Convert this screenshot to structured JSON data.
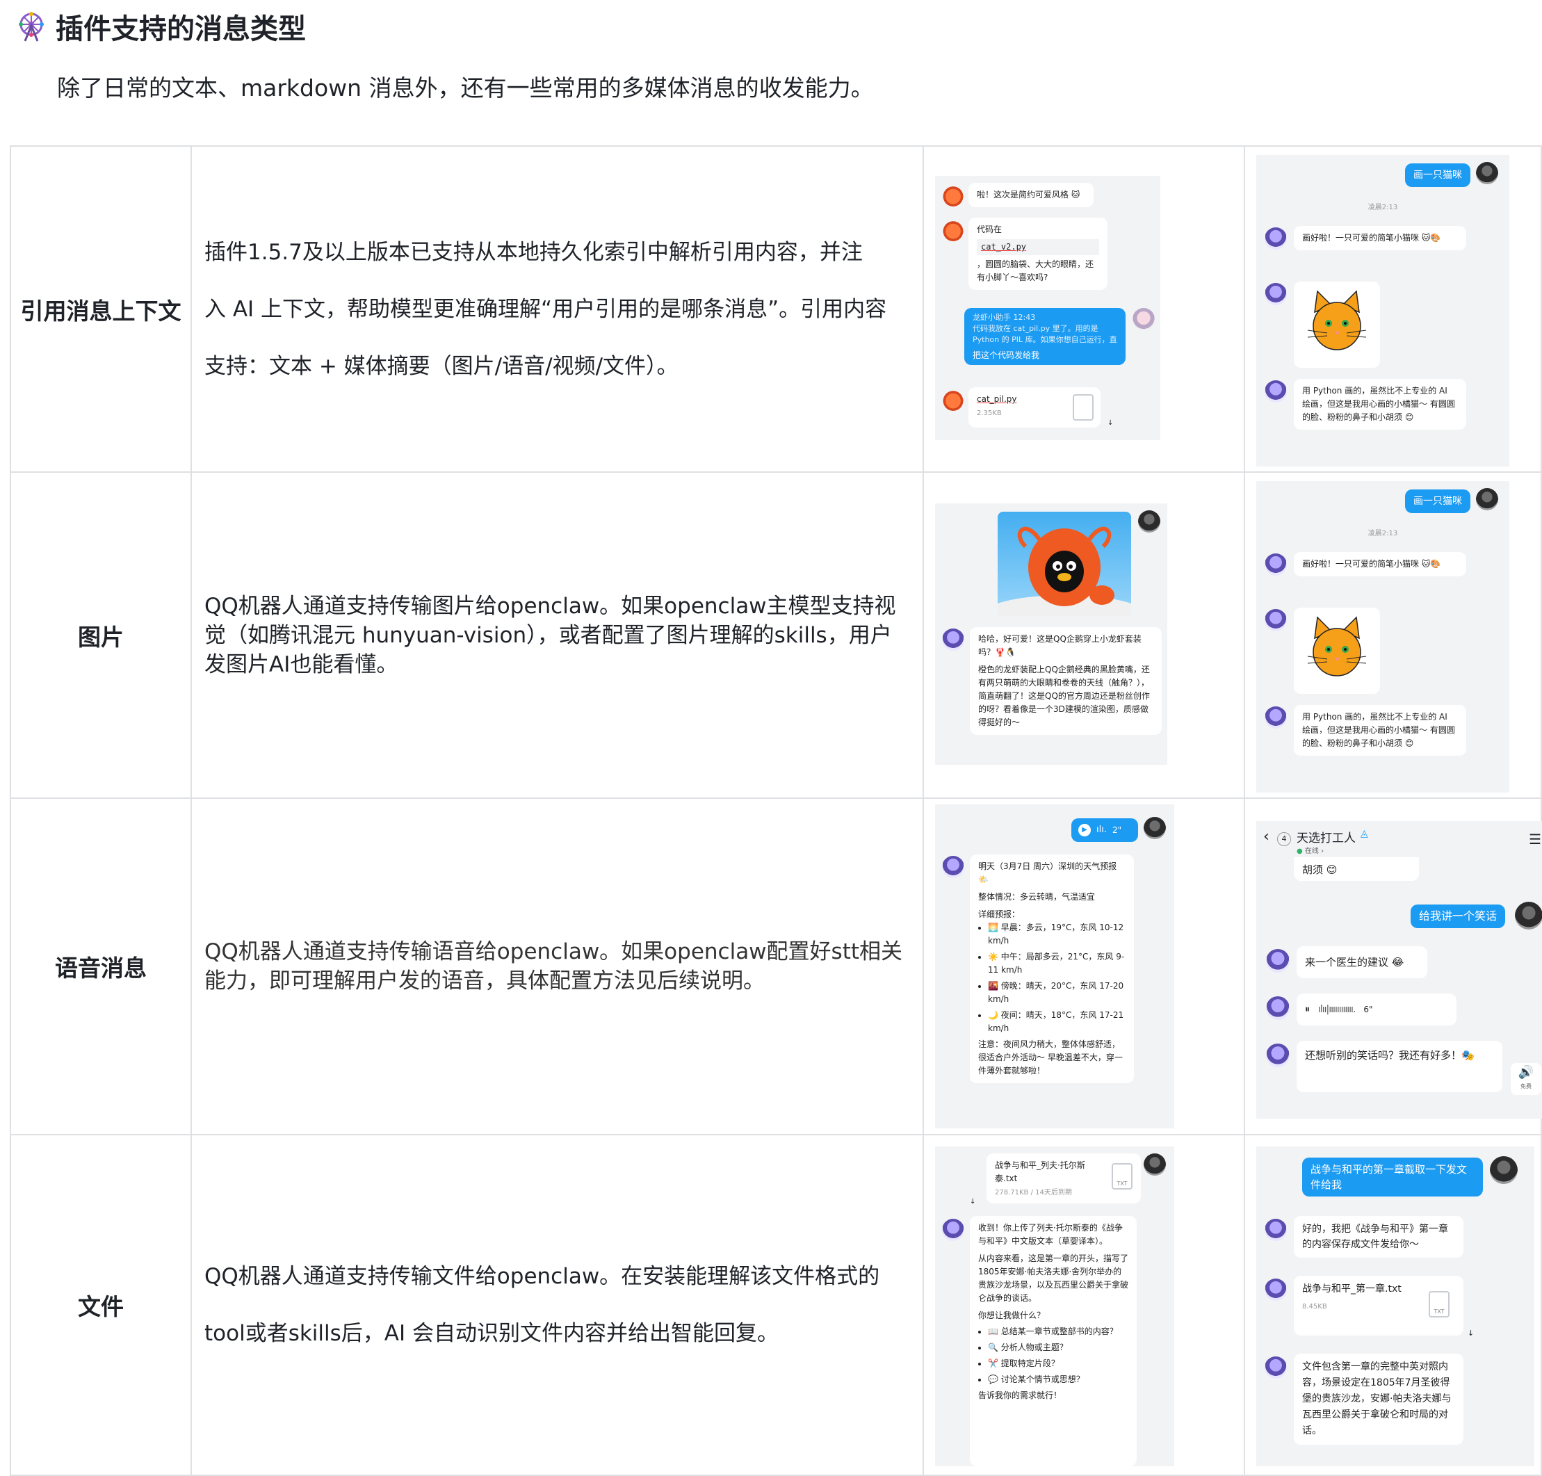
{
  "heading": {
    "icon": "ferris-wheel-icon",
    "title": "插件支持的消息类型"
  },
  "intro": "除了日常的文本、markdown 消息外，还有一些常用的多媒体消息的收发能力。",
  "rows": [
    {
      "label": "引用消息上下文",
      "desc_lines": [
        "插件1.5.7及以上版本已支持从本地持久化索引中解析引用内容，并注",
        "入 AI 上下文，帮助模型更准确理解“用户引用的是哪条消息”。引用内容",
        "支持：文本 + 媒体摘要（图片/语音/视频/文件）。"
      ]
    },
    {
      "label": "图片",
      "desc_lines": [
        "QQ机器人通道支持传输图片给openclaw。如果openclaw主模型支持视",
        "觉（如腾讯混元 hunyuan-vision），或者配置了图片理解的skills，用户",
        "发图片AI也能看懂。"
      ]
    },
    {
      "label": "语音消息",
      "desc_lines": [
        "QQ机器人通道支持传输语音给openclaw。如果openclaw配置好stt相关",
        "能力，即可理解用户发的语音，具体配置方法见后续说明。"
      ]
    },
    {
      "label": "文件",
      "desc_lines": [
        "QQ机器人通道支持传输文件给openclaw。在安装能理解该文件格式的",
        "tool或者skills后，AI 会自动识别文件内容并给出智能回复。"
      ]
    }
  ],
  "shots": {
    "quote_left": {
      "msg1": "啦！这次是简约可爱风格 🐱",
      "msg2_title": "代码在",
      "msg2_code": "cat_v2.py",
      "msg2_text": "，圆圆的脑袋、大大的眼睛，还有小脚丫～喜欢吗?",
      "quote_meta": "龙虾小助手 12:43",
      "quote_text": "代码我放在 cat_pil.py 里了。用的是 Python 的 PIL 库。如果你想自己运行，直接 pyt...",
      "quote_reply": "把这个代码发给我",
      "file_name": "cat_pil.py",
      "file_size": "2.35KB"
    },
    "draw_cat": {
      "user_msg": "画一只猫咪",
      "time": "凌晨2:13",
      "bot_msg1": "画好啦！一只可爱的简笔小猫咪 🐱🎨",
      "bot_msg2": "用 Python 画的，虽然比不上专业的 AI 绘画，但这是我用心画的小橘猫～ 有圆圆的脸、粉粉的鼻子和小胡须 😊"
    },
    "image_left": {
      "reply1": "哈哈，好可爱！这是QQ企鹅穿上小龙虾套装吗？🦞🐧",
      "reply2": "橙色的龙虾装配上QQ企鹅经典的黑脸黄嘴，还有两只萌萌的大眼睛和卷卷的天线（触角？），简直萌翻了！这是QQ的官方周边还是粉丝创作的呀？看着像是一个3D建模的渲染图，质感做得挺好的～"
    },
    "voice_left": {
      "duration": "2\"",
      "weather_title": "明天（3月7日 周六）深圳的天气预报 🌤️",
      "overall": "整体情况：多云转晴，气温适宜",
      "detail_label": "详细预报：",
      "items": [
        "🌅 早晨：多云，19°C，东风 10-12 km/h",
        "☀️ 中午：局部多云，21°C，东风 9-11 km/h",
        "🌇 傍晚：晴天，20°C，东风 17-20 km/h",
        "🌙 夜间：晴天，18°C，东风 17-21 km/h"
      ],
      "note": "注意：夜间风力稍大，整体体感舒适，很适合户外活动～ 早晚温差不大，穿一件薄外套就够啦！"
    },
    "voice_right": {
      "unread": "4",
      "contact": "天选打工人",
      "status": "在线 ›",
      "prev_tail": "胡须 😊",
      "user_msg": "给我讲一个笑话",
      "bot_msg1": "来一个医生的建议 😂",
      "voice_len": "6\"",
      "bot_msg2": "还想听别的笑话吗？我还有好多！🎭",
      "speaker_label": "免费"
    },
    "file_left": {
      "file_name": "战争与和平_列夫·托尔斯泰.txt",
      "file_meta": "278.71KB / 14天后到期",
      "reply_p1": "收到！你上传了列夫·托尔斯泰的《战争与和平》中文版文本（草婴译本）。",
      "reply_p2": "从内容来看，这是第一章的开头，描写了1805年安娜·帕夫洛夫娜·舍列尔举办的贵族沙龙场景，以及瓦西里公爵关于拿破仑战争的谈话。",
      "reply_q": "你想让我做什么？",
      "items": [
        "📖 总结某一章节或整部书的内容？",
        "🔍 分析人物或主题？",
        "✂️ 提取特定片段？",
        "💬 讨论某个情节或思想？"
      ],
      "tail": "告诉我你的需求就行！"
    },
    "file_right": {
      "user_msg": "战争与和平的第一章截取一下发文件给我",
      "bot_msg1": "好的，我把《战争与和平》第一章的内容保存成文件发给你～",
      "file_name": "战争与和平_第一章.txt",
      "file_size": "8.45KB",
      "bot_msg2": "文件包含第一章的完整中英对照内容，场景设定在1805年7月圣彼得堡的贵族沙龙，安娜·帕夫洛夫娜与瓦西里公爵关于拿破仑和时局的对话。"
    },
    "txt_label": "TXT"
  }
}
